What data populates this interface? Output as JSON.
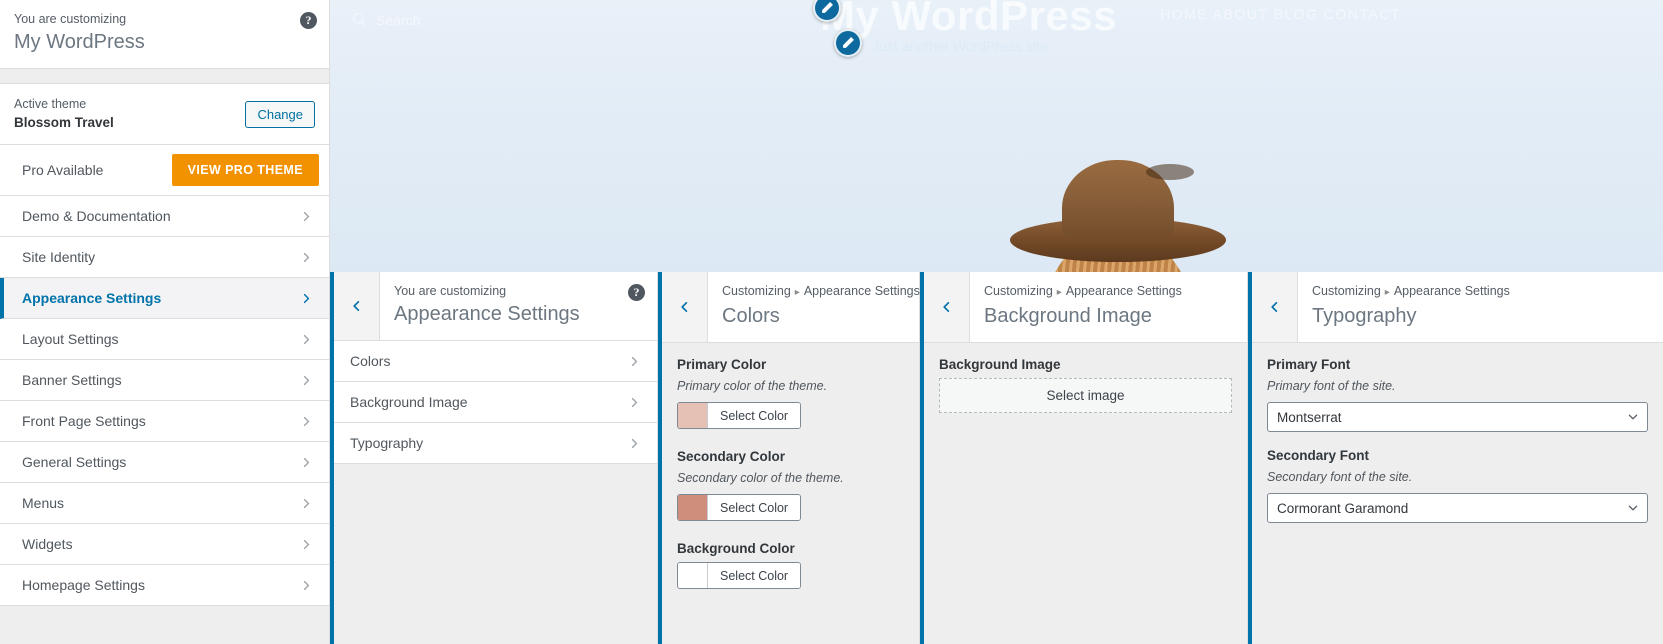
{
  "preview": {
    "site_title": "My WordPress",
    "site_tagline": "Just another WordPress site",
    "nav_text": "HOME   ABOUT   BLOG   CONTACT",
    "search_placeholder": "Search"
  },
  "sidebar": {
    "eyebrow": "You are customizing",
    "title": "My WordPress",
    "help_icon": "?",
    "theme": {
      "label": "Active theme",
      "name": "Blossom Travel",
      "change_label": "Change"
    },
    "pro": {
      "label": "Pro Available",
      "button_label": "VIEW PRO THEME",
      "button_color": "#f39200"
    },
    "items": [
      {
        "label": "Demo & Documentation",
        "active": false
      },
      {
        "label": "Site Identity",
        "active": false
      },
      {
        "label": "Appearance Settings",
        "active": true
      },
      {
        "label": "Layout Settings",
        "active": false
      },
      {
        "label": "Banner Settings",
        "active": false
      },
      {
        "label": "Front Page Settings",
        "active": false
      },
      {
        "label": "General Settings",
        "active": false
      },
      {
        "label": "Menus",
        "active": false
      },
      {
        "label": "Widgets",
        "active": false
      },
      {
        "label": "Homepage Settings",
        "active": false
      }
    ]
  },
  "panel_appearance": {
    "eyebrow": "You are customizing",
    "title": "Appearance Settings",
    "help_icon": "?",
    "items": [
      {
        "label": "Colors"
      },
      {
        "label": "Background Image"
      },
      {
        "label": "Typography"
      }
    ]
  },
  "panel_colors": {
    "crumb_root": "Customizing",
    "crumb_parent": "Appearance Settings",
    "title": "Colors",
    "controls": [
      {
        "label": "Primary Color",
        "description": "Primary color of the theme.",
        "button_label": "Select Color",
        "value": "#e4c0b5"
      },
      {
        "label": "Secondary Color",
        "description": "Secondary color of the theme.",
        "button_label": "Select Color",
        "value": "#cf8d7c"
      },
      {
        "label": "Background Color",
        "description": "",
        "button_label": "Select Color",
        "value": "#ffffff"
      }
    ]
  },
  "panel_background": {
    "crumb_root": "Customizing",
    "crumb_parent": "Appearance Settings",
    "title": "Background Image",
    "control": {
      "label": "Background Image",
      "button_label": "Select image"
    }
  },
  "panel_typography": {
    "crumb_root": "Customizing",
    "crumb_parent": "Appearance Settings",
    "title": "Typography",
    "controls": [
      {
        "label": "Primary Font",
        "description": "Primary font of the site.",
        "value": "Montserrat"
      },
      {
        "label": "Secondary Font",
        "description": "Secondary font of the site.",
        "value": "Cormorant Garamond"
      }
    ]
  }
}
